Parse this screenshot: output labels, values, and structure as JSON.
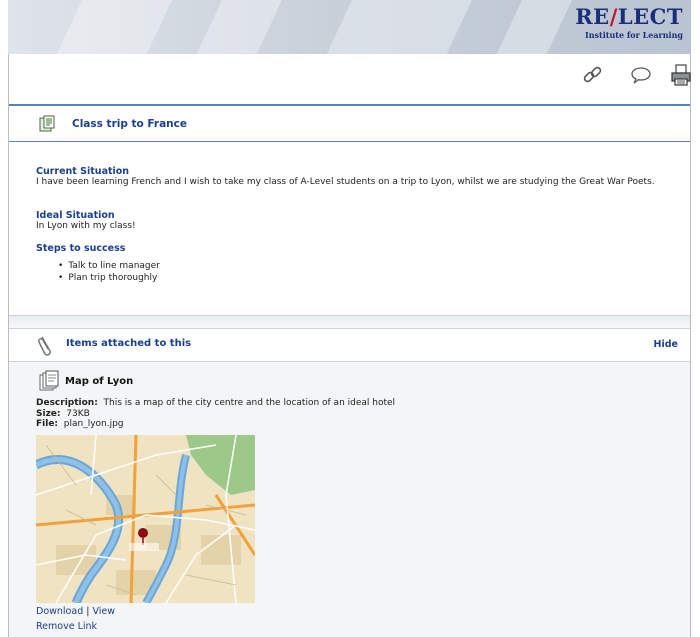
{
  "brand": {
    "logo_main_a": "RE",
    "logo_slash": "/",
    "logo_main_b": "LECT",
    "logo_sub": "Institute for Learning"
  },
  "toolbar": {
    "icons": [
      "link-icon",
      "comment-icon",
      "printer-icon"
    ]
  },
  "plan": {
    "title": "Class trip to France",
    "current_heading": "Current Situation",
    "current_text": "I have been learning French and I wish to take my class of A-Level students on a trip to Lyon, whilst we are studying the Great War Poets.",
    "ideal_heading": "Ideal Situation",
    "ideal_text": "In Lyon with my class!",
    "steps_heading": "Steps to success",
    "steps": [
      "Talk to line manager",
      "Plan trip thoroughly"
    ]
  },
  "attachments": {
    "heading": "Items attached to this",
    "hide_label": "Hide",
    "item": {
      "title": "Map of Lyon",
      "description_label": "Description:",
      "description": "This is a map of the city centre and the location of an ideal hotel",
      "size_label": "Size:",
      "size": "73KB",
      "file_label": "File:",
      "file": "plan_lyon.jpg",
      "download_label": "Download",
      "separator": "|",
      "view_label": "View",
      "remove_label": "Remove Link"
    }
  },
  "colors": {
    "accent": "#1a3f8f",
    "rule": "#5b7fb8",
    "brand_red": "#c8102e"
  }
}
